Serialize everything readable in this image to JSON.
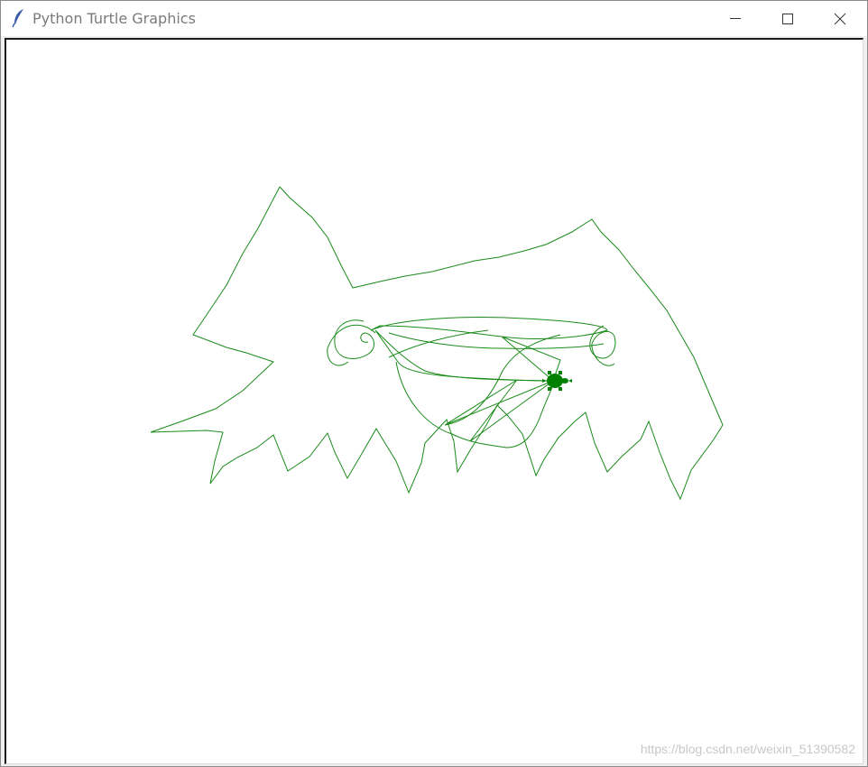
{
  "window": {
    "title": "Python Turtle Graphics",
    "icon": "feather-icon",
    "controls": [
      "minimize-icon",
      "maximize-icon",
      "close-icon"
    ]
  },
  "canvas": {
    "background": "#ffffff",
    "pen_color": "#008000",
    "turtle_color": "#008000",
    "turtle_shape": "turtle-icon"
  },
  "watermark": {
    "text": "https://blog.csdn.net/weixin_51390582"
  }
}
